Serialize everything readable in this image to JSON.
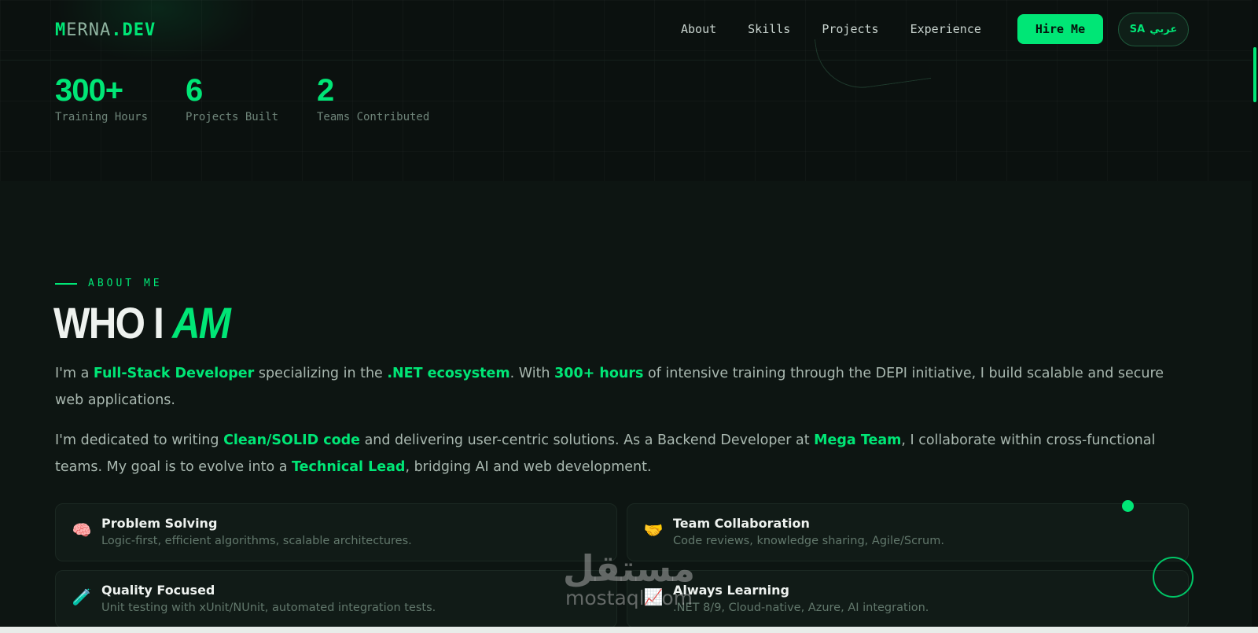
{
  "nav": {
    "logo": {
      "first": "M",
      "mid": "ERNA",
      "dot": ".",
      "end": "DEV"
    },
    "links": [
      "About",
      "Skills",
      "Projects",
      "Experience"
    ],
    "hire_label": "Hire Me",
    "lang": {
      "code": "SA",
      "label": "عربي"
    }
  },
  "stats": [
    {
      "value": "300+",
      "label": "Training Hours"
    },
    {
      "value": "6",
      "label": "Projects Built"
    },
    {
      "value": "2",
      "label": "Teams Contributed"
    }
  ],
  "about": {
    "tag": "ABOUT ME",
    "title_main": "WHO I ",
    "title_accent": "AM",
    "p1": {
      "t1": "I'm a ",
      "b1": "Full-Stack Developer",
      "t2": " specializing in the ",
      "b2": ".NET ecosystem",
      "t3": ". With ",
      "b3": "300+ hours",
      "t4": " of intensive training through the DEPI initiative, I build scalable and secure web applications."
    },
    "p2": {
      "t1": "I'm dedicated to writing ",
      "b1": "Clean/SOLID code",
      "t2": " and delivering user-centric solutions. As a Backend Developer at ",
      "b2": "Mega Team",
      "t3": ", I collaborate within cross-functional teams. My goal is to evolve into a ",
      "b3": "Technical Lead",
      "t4": ", bridging AI and web development."
    },
    "cards": [
      {
        "icon": "brain-icon",
        "glyph": "🧠",
        "title": "Problem Solving",
        "desc": "Logic-first, efficient algorithms, scalable architectures."
      },
      {
        "icon": "handshake-icon",
        "glyph": "🤝",
        "title": "Team Collaboration",
        "desc": "Code reviews, knowledge sharing, Agile/Scrum."
      },
      {
        "icon": "test-tube-icon",
        "glyph": "🧪",
        "title": "Quality Focused",
        "desc": "Unit testing with xUnit/NUnit, automated integration tests."
      },
      {
        "icon": "chart-up-icon",
        "glyph": "📈",
        "title": "Always Learning",
        "desc": ".NET 8/9, Cloud-native, Azure, AI integration."
      }
    ]
  },
  "watermark": {
    "arabic": "مستقل",
    "latin": "mostaql.com"
  },
  "colors": {
    "accent": "#00e676",
    "background": "#0d1512",
    "card": "#111b17"
  }
}
